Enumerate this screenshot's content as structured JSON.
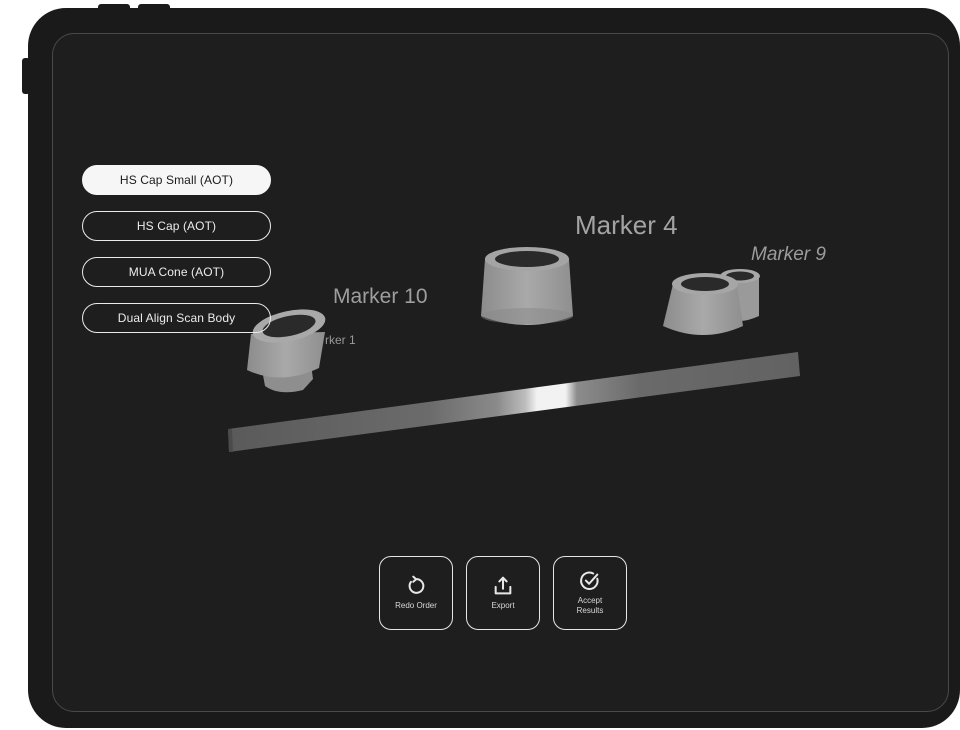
{
  "implant_options": [
    {
      "label": "HS Cap Small (AOT)",
      "selected": true
    },
    {
      "label": "HS Cap (AOT)",
      "selected": false
    },
    {
      "label": "MUA Cone (AOT)",
      "selected": false
    },
    {
      "label": "Dual Align Scan Body",
      "selected": false
    }
  ],
  "markers": {
    "marker_4": "Marker 4",
    "marker_9": "Marker 9",
    "marker_10": "Marker 10",
    "marker_1": "rker 1"
  },
  "actions": {
    "redo_order": {
      "label": "Redo Order",
      "icon": "redo-icon"
    },
    "export": {
      "label": "Export",
      "icon": "export-icon"
    },
    "accept_results": {
      "label": "Accept Results",
      "icon": "accept-check-icon"
    }
  },
  "colors": {
    "device_body": "#1b1a1b",
    "screen_bg": "#1f1e1f",
    "model_gray": "#9d9d9d",
    "selected_button_bg": "#f6f6f6"
  }
}
